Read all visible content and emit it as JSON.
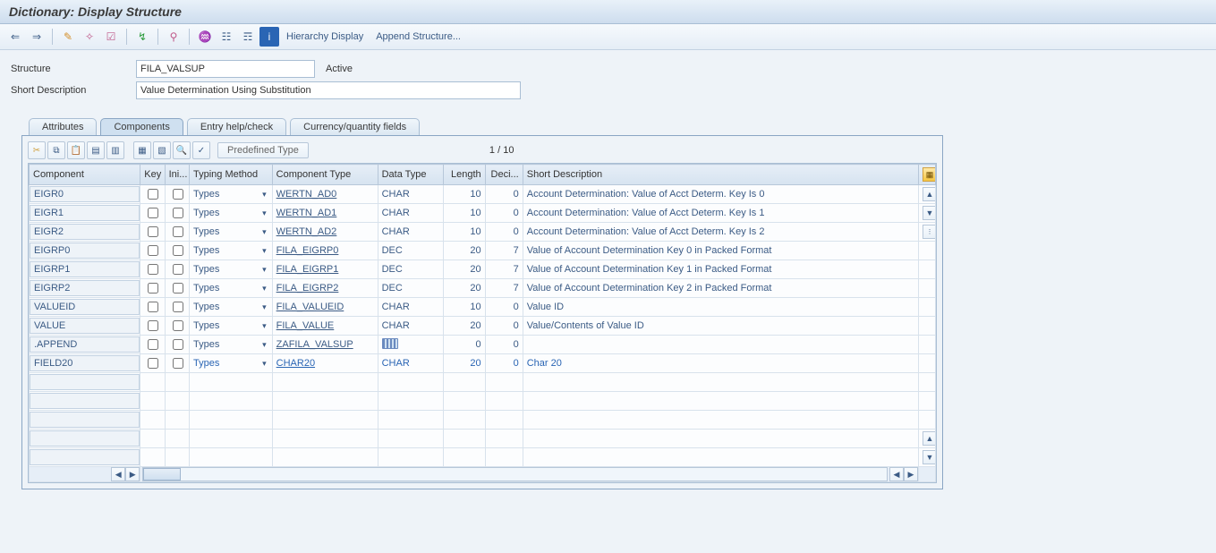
{
  "titlebar": {
    "title": "Dictionary: Display Structure"
  },
  "apptoolbar": {
    "hierarchy_label": "Hierarchy Display",
    "append_label": "Append Structure..."
  },
  "form": {
    "structure_label": "Structure",
    "structure_value": "FILA_VALSUP",
    "status_text": "Active",
    "short_desc_label": "Short Description",
    "short_desc_value": "Value Determination Using Substitution"
  },
  "tabs": {
    "attributes": "Attributes",
    "components": "Components",
    "entry_help": "Entry help/check",
    "currency": "Currency/quantity fields"
  },
  "grid_toolbar": {
    "predefined_label": "Predefined Type",
    "counter": "1  /  10"
  },
  "grid": {
    "headers": {
      "component": "Component",
      "key": "Key",
      "ini": "Ini...",
      "typing": "Typing Method",
      "comptype": "Component Type",
      "datatype": "Data Type",
      "length": "Length",
      "deci": "Deci...",
      "shortdesc": "Short Description"
    },
    "rows": [
      {
        "component": "EIGR0",
        "typing": "Types",
        "comptype": "WERTN_AD0",
        "datatype": "CHAR",
        "length": "10",
        "deci": "0",
        "desc": "Account Determination: Value of Acct Determ. Key Is 0",
        "new": false
      },
      {
        "component": "EIGR1",
        "typing": "Types",
        "comptype": "WERTN_AD1",
        "datatype": "CHAR",
        "length": "10",
        "deci": "0",
        "desc": "Account Determination: Value of Acct Determ. Key Is 1",
        "new": false
      },
      {
        "component": "EIGR2",
        "typing": "Types",
        "comptype": "WERTN_AD2",
        "datatype": "CHAR",
        "length": "10",
        "deci": "0",
        "desc": "Account Determination: Value of Acct Determ. Key Is 2",
        "new": false
      },
      {
        "component": "EIGRP0",
        "typing": "Types",
        "comptype": "FILA_EIGRP0",
        "datatype": "DEC",
        "length": "20",
        "deci": "7",
        "desc": "Value of Account Determination Key 0 in Packed Format",
        "new": false
      },
      {
        "component": "EIGRP1",
        "typing": "Types",
        "comptype": "FILA_EIGRP1",
        "datatype": "DEC",
        "length": "20",
        "deci": "7",
        "desc": "Value of Account Determination Key 1 in Packed Format",
        "new": false
      },
      {
        "component": "EIGRP2",
        "typing": "Types",
        "comptype": "FILA_EIGRP2",
        "datatype": "DEC",
        "length": "20",
        "deci": "7",
        "desc": "Value of Account Determination Key 2 in Packed Format",
        "new": false
      },
      {
        "component": "VALUEID",
        "typing": "Types",
        "comptype": "FILA_VALUEID",
        "datatype": "CHAR",
        "length": "10",
        "deci": "0",
        "desc": "Value ID",
        "new": false
      },
      {
        "component": "VALUE",
        "typing": "Types",
        "comptype": "FILA_VALUE",
        "datatype": "CHAR",
        "length": "20",
        "deci": "0",
        "desc": "Value/Contents of Value ID",
        "new": false
      },
      {
        "component": ".APPEND",
        "typing": "Types",
        "comptype": "ZAFILA_VALSUP",
        "datatype": "",
        "length": "0",
        "deci": "0",
        "desc": "",
        "new": false,
        "dtype_icon": true
      },
      {
        "component": "FIELD20",
        "typing": "Types",
        "comptype": "CHAR20",
        "datatype": "CHAR",
        "length": "20",
        "deci": "0",
        "desc": "Char 20",
        "new": true
      }
    ],
    "empty_rows": 5
  }
}
